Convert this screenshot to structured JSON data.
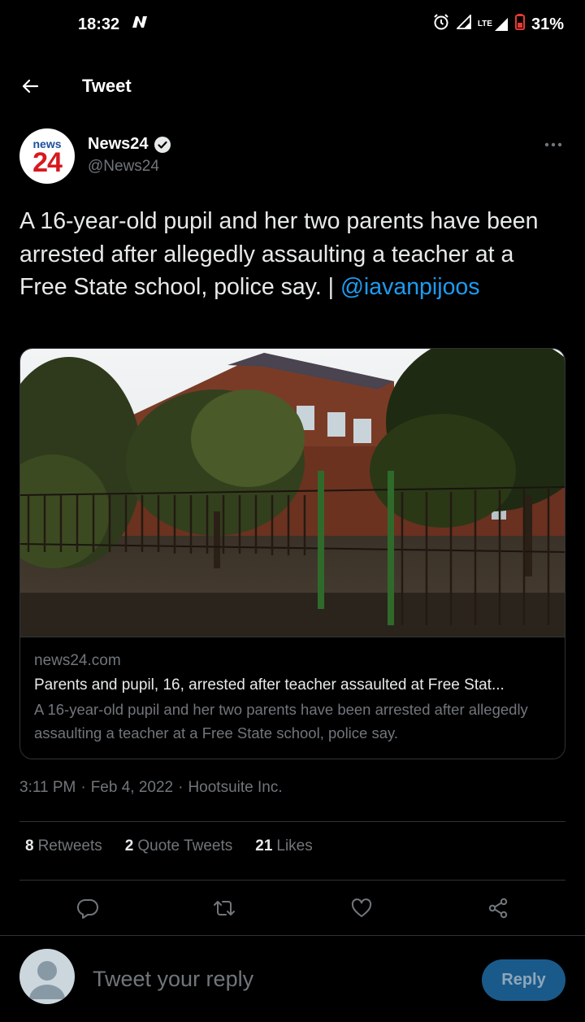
{
  "status_bar": {
    "time": "18:32",
    "network_label": "LTE",
    "battery_percent": "31%",
    "icons": [
      "n-app-icon",
      "alarm-icon",
      "signal-icon",
      "lte-signal-icon",
      "battery-icon"
    ]
  },
  "header": {
    "title": "Tweet"
  },
  "author": {
    "logo_top": "news",
    "logo_bottom": "24",
    "name": "News24",
    "handle": "@News24",
    "verified": true
  },
  "tweet": {
    "text": "A 16-year-old pupil and her two parents have been arrested after allegedly assaulting a teacher at a Free State school, police say. | ",
    "mention": "@iavanpijoos"
  },
  "card": {
    "domain": "news24.com",
    "title": "Parents and pupil, 16, arrested after teacher assaulted at Free Stat...",
    "description": "A 16-year-old pupil and her two parents have been arrested after allegedly assaulting a teacher at a Free State school, police say."
  },
  "meta": {
    "time": "3:11 PM",
    "sep1": "·",
    "date": "Feb 4, 2022",
    "sep2": "·",
    "source": "Hootsuite Inc."
  },
  "stats": {
    "retweets_count": "8",
    "retweets_label": "Retweets",
    "quotes_count": "2",
    "quotes_label": "Quote Tweets",
    "likes_count": "21",
    "likes_label": "Likes"
  },
  "actions": [
    "reply-icon",
    "retweet-icon",
    "like-icon",
    "share-icon"
  ],
  "reply": {
    "placeholder": "Tweet your reply",
    "button_label": "Reply"
  },
  "colors": {
    "background": "#000000",
    "text": "#e7e9ea",
    "secondary_text": "#71767b",
    "accent": "#1d9bf0",
    "reply_button": "#1a5a8a"
  }
}
